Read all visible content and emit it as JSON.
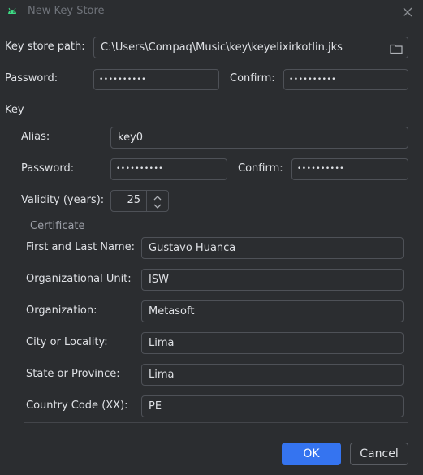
{
  "window": {
    "title": "New Key Store",
    "close_icon": "close-icon",
    "app_icon": "android-icon"
  },
  "keystore": {
    "path_label": "Key store path:",
    "path_value": "C:\\Users\\Compaq\\Music\\key\\keyelixirkotlin.jks",
    "password_label": "Password:",
    "password_value": "••••••••••",
    "confirm_label": "Confirm:",
    "confirm_value": "••••••••••"
  },
  "key": {
    "section_label": "Key",
    "alias_label": "Alias:",
    "alias_value": "key0",
    "password_label": "Password:",
    "password_value": "••••••••••",
    "confirm_label": "Confirm:",
    "confirm_value": "••••••••••",
    "validity_label": "Validity (years):",
    "validity_value": "25"
  },
  "certificate": {
    "title": "Certificate",
    "fields": [
      {
        "label": "First and Last Name:",
        "value": "Gustavo Huanca"
      },
      {
        "label": "Organizational Unit:",
        "value": "ISW"
      },
      {
        "label": "Organization:",
        "value": "Metasoft"
      },
      {
        "label": "City or Locality:",
        "value": "Lima"
      },
      {
        "label": "State or Province:",
        "value": "Lima"
      },
      {
        "label": "Country Code (XX):",
        "value": "PE"
      }
    ]
  },
  "buttons": {
    "ok": "OK",
    "cancel": "Cancel"
  },
  "colors": {
    "background": "#2b2d30",
    "accent": "#3574f0",
    "border": "#4e5157",
    "text": "#dfe1e5"
  }
}
